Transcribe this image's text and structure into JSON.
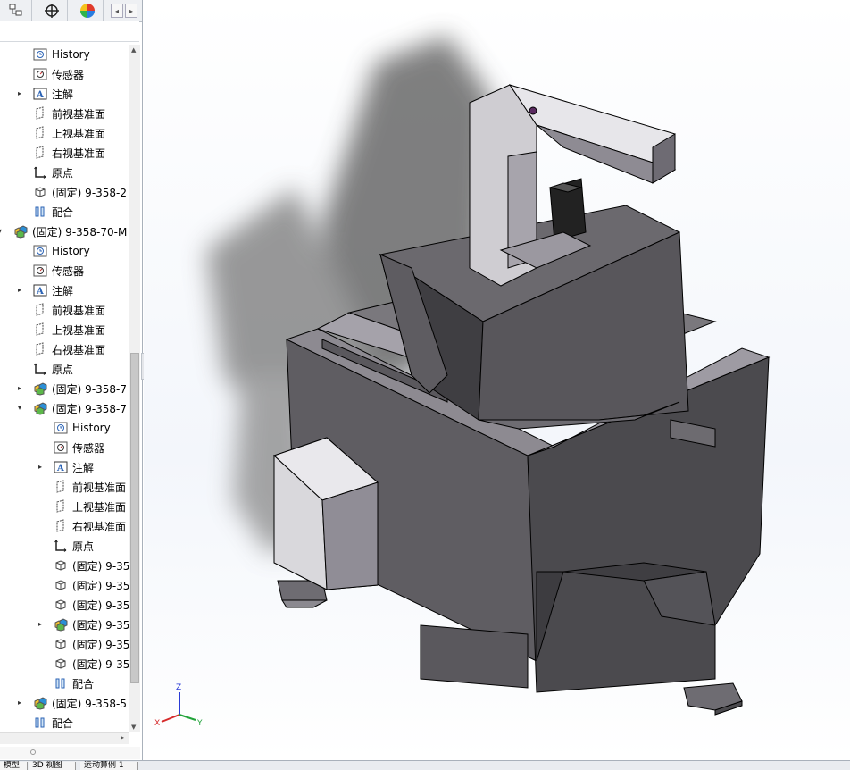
{
  "tree": {
    "rows": [
      {
        "label": "History",
        "indent": 1,
        "icon": "history",
        "expander": ""
      },
      {
        "label": "传感器",
        "indent": 1,
        "icon": "sensor",
        "expander": ""
      },
      {
        "label": "注解",
        "indent": 1,
        "icon": "annotation",
        "expander": "▸"
      },
      {
        "label": "前视基准面",
        "indent": 1,
        "icon": "plane",
        "expander": ""
      },
      {
        "label": "上视基准面",
        "indent": 1,
        "icon": "plane",
        "expander": ""
      },
      {
        "label": "右视基准面",
        "indent": 1,
        "icon": "plane",
        "expander": ""
      },
      {
        "label": "原点",
        "indent": 1,
        "icon": "origin",
        "expander": ""
      },
      {
        "label": "(固定) 9-358-2",
        "indent": 1,
        "icon": "part",
        "expander": ""
      },
      {
        "label": "配合",
        "indent": 1,
        "icon": "mates",
        "expander": ""
      },
      {
        "label": "(固定) 9-358-70-M",
        "indent": 0,
        "icon": "assembly",
        "expander": "▾"
      },
      {
        "label": "History",
        "indent": 1,
        "icon": "history",
        "expander": ""
      },
      {
        "label": "传感器",
        "indent": 1,
        "icon": "sensor",
        "expander": ""
      },
      {
        "label": "注解",
        "indent": 1,
        "icon": "annotation",
        "expander": "▸"
      },
      {
        "label": "前视基准面",
        "indent": 1,
        "icon": "plane",
        "expander": ""
      },
      {
        "label": "上视基准面",
        "indent": 1,
        "icon": "plane",
        "expander": ""
      },
      {
        "label": "右视基准面",
        "indent": 1,
        "icon": "plane",
        "expander": ""
      },
      {
        "label": "原点",
        "indent": 1,
        "icon": "origin",
        "expander": ""
      },
      {
        "label": "(固定) 9-358-7",
        "indent": 1,
        "icon": "assembly",
        "expander": "▸"
      },
      {
        "label": "(固定) 9-358-7",
        "indent": 1,
        "icon": "assembly",
        "expander": "▾"
      },
      {
        "label": "History",
        "indent": 2,
        "icon": "history",
        "expander": ""
      },
      {
        "label": "传感器",
        "indent": 2,
        "icon": "sensor",
        "expander": ""
      },
      {
        "label": "注解",
        "indent": 2,
        "icon": "annotation",
        "expander": "▸"
      },
      {
        "label": "前视基准面",
        "indent": 2,
        "icon": "plane",
        "expander": ""
      },
      {
        "label": "上视基准面",
        "indent": 2,
        "icon": "plane",
        "expander": ""
      },
      {
        "label": "右视基准面",
        "indent": 2,
        "icon": "plane",
        "expander": ""
      },
      {
        "label": "原点",
        "indent": 2,
        "icon": "origin",
        "expander": ""
      },
      {
        "label": "(固定) 9-35",
        "indent": 2,
        "icon": "part",
        "expander": ""
      },
      {
        "label": "(固定) 9-35",
        "indent": 2,
        "icon": "part",
        "expander": ""
      },
      {
        "label": "(固定) 9-35",
        "indent": 2,
        "icon": "part",
        "expander": ""
      },
      {
        "label": "(固定) 9-35",
        "indent": 2,
        "icon": "assembly",
        "expander": "▸"
      },
      {
        "label": "(固定) 9-35",
        "indent": 2,
        "icon": "part",
        "expander": ""
      },
      {
        "label": "(固定) 9-35",
        "indent": 2,
        "icon": "part",
        "expander": ""
      },
      {
        "label": "配合",
        "indent": 2,
        "icon": "mates",
        "expander": ""
      },
      {
        "label": "(固定) 9-358-5",
        "indent": 1,
        "icon": "assembly",
        "expander": "▸"
      },
      {
        "label": "配合",
        "indent": 1,
        "icon": "mates",
        "expander": ""
      }
    ]
  },
  "tabs": [
    "模型",
    "3D 视图",
    "运动算例 1"
  ],
  "triad": {
    "x": "X",
    "y": "Y",
    "z": "Z"
  }
}
